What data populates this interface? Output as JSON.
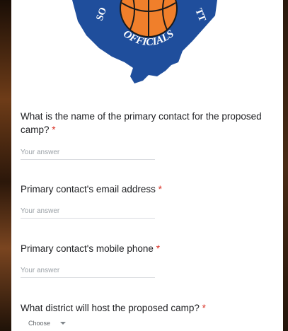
{
  "logo": {
    "text_left": "SO",
    "text_right": "TT",
    "text_bottom": "OFFICIALS"
  },
  "questions": [
    {
      "label": "What is the name of the primary contact for the proposed camp?",
      "required": "*",
      "placeholder": "Your answer"
    },
    {
      "label": "Primary contact's email address",
      "required": "*",
      "placeholder": "Your answer"
    },
    {
      "label": "Primary contact's mobile phone",
      "required": "*",
      "placeholder": "Your answer"
    },
    {
      "label": "What district will host the proposed camp?",
      "required": "*",
      "select_value": "Choose"
    }
  ],
  "colors": {
    "required": "#d93025",
    "logo_blue": "#1f4e9c",
    "ball_orange": "#f07f2b"
  }
}
